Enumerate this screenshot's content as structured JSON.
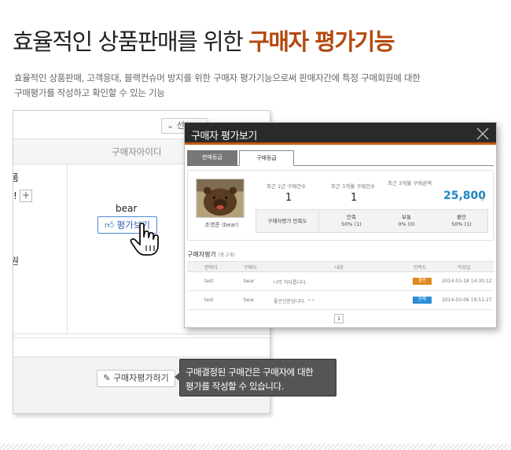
{
  "header": {
    "title_plain": "효율적인 상품판매를 위한",
    "title_highlight": "구매자 평가기능",
    "description_line1": "효율적인 상품판매, 고객응대, 블랙컨슈머 방지를 위한 구매자 평가기능으로써 판매자간에 특정 구매회원에 대한",
    "description_line2": "구매평가를 작성하고 확인할 수 있는 기능"
  },
  "admin_panel": {
    "select_value": "⌄ 선",
    "column_left": "자",
    "column_buyer_id": "구매자아이디",
    "row_text_1": "품",
    "row_text_2": "!",
    "row_text_3": "원",
    "expand_symbol": "+",
    "buyer_id": "bear",
    "view_eval_button": "평가보기",
    "write_eval_button": "구매자평가하기"
  },
  "popup": {
    "title": "구매자 평가보기",
    "tabs": [
      {
        "label": "판매등급",
        "active": false
      },
      {
        "label": "구매등급",
        "active": true
      }
    ],
    "user_name": "조영준 (bear)",
    "stats": [
      {
        "label": "최근 1년 구매건수",
        "value": "1"
      },
      {
        "label": "최근 3개월 구매건수",
        "value": "1"
      }
    ],
    "amount_label": "최근 3개월 구매금액",
    "amount_value": "25,800",
    "amount_unit": "원",
    "satisfaction_label": "구매자평가 만족도",
    "satisfaction": [
      {
        "label": "만족",
        "value": "50% (1)"
      },
      {
        "label": "보통",
        "value": "0% (0)"
      },
      {
        "label": "불만",
        "value": "50% (1)"
      }
    ],
    "reviews_title": "구매자평가",
    "reviews_count": "(총 2개)",
    "table_headers": [
      "판매자",
      "구매자",
      "내용",
      "만족도",
      "작성일"
    ],
    "rows": [
      {
        "seller": "test",
        "buyer": "bear",
        "content": "너무 하다릅니다.",
        "rating": "불만",
        "date": "2014-03-18 14:30:12"
      },
      {
        "seller": "test",
        "buyer": "bear",
        "content": "좋은신분입니다. ^^",
        "rating": "만족",
        "date": "2014-03-06 19:51:27"
      }
    ],
    "page": "1"
  },
  "tooltip": {
    "line1": "구매결정된 구매건은 구매자에 대한",
    "line2": "평가를 작성할 수 있습니다."
  },
  "colors": {
    "highlight": "#b4490e",
    "popup_header": "#2a2a2a",
    "popup_accent": "#c85a14",
    "amount": "#1f86c4",
    "badge_bad": "#e08a1e",
    "badge_good": "#2a8fd8"
  }
}
